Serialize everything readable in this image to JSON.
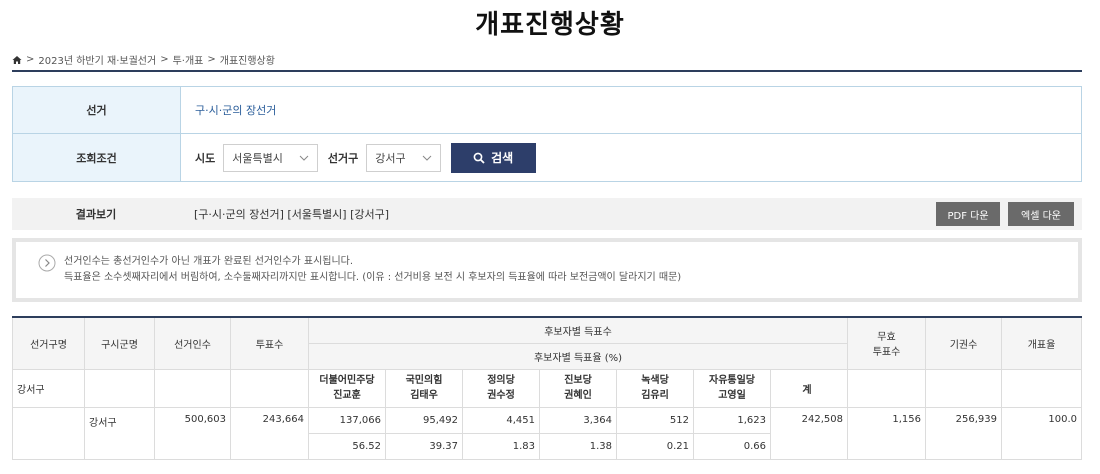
{
  "page_title": "개표진행상황",
  "breadcrumb": {
    "items": [
      "2023년 하반기 재·보궐선거",
      "투·개표",
      "개표진행상황"
    ],
    "separator": ">"
  },
  "search": {
    "election_label": "선거",
    "election_value": "구·시·군의 장선거",
    "condition_label": "조회조건",
    "sido_label": "시도",
    "sido_value": "서울특별시",
    "district_label": "선거구",
    "district_value": "강서구",
    "search_button": "검색"
  },
  "result": {
    "label": "결과보기",
    "value": "[구·시·군의 장선거] [서울특별시] [강서구]",
    "pdf_button": "PDF 다운",
    "excel_button": "엑셀 다운"
  },
  "notice": {
    "line1": "선거인수는 총선거인수가 아닌 개표가 완료된 선거인수가 표시됩니다.",
    "line2": "득표율은 소수셋째자리에서 버림하여, 소수둘째자리까지만 표시합니다. (이유 : 선거비용 보전 시 후보자의 득표율에 따라 보전금액이 달라지기 때문)"
  },
  "table": {
    "headers": {
      "district": "선거구명",
      "sigungu": "구시군명",
      "electors": "선거인수",
      "votes": "투표수",
      "cand_votes": "후보자별 득표수",
      "cand_rate": "후보자별 득표율 (%)",
      "invalid_1": "무효",
      "invalid_2": "투표수",
      "abstain": "기권수",
      "progress": "개표율"
    },
    "district_name": "강서구",
    "candidates": [
      {
        "party": "더불어민주당",
        "name": "진교훈"
      },
      {
        "party": "국민의힘",
        "name": "김태우"
      },
      {
        "party": "정의당",
        "name": "권수정"
      },
      {
        "party": "진보당",
        "name": "권혜인"
      },
      {
        "party": "녹색당",
        "name": "김유리"
      },
      {
        "party": "자유통일당",
        "name": "고영일"
      }
    ],
    "total_label": "계",
    "row": {
      "sigungu": "강서구",
      "electors": "500,603",
      "votes": "243,664",
      "cand_votes": [
        "137,066",
        "95,492",
        "4,451",
        "3,364",
        "512",
        "1,623"
      ],
      "total": "242,508",
      "invalid": "1,156",
      "abstain": "256,939",
      "progress": "100.0",
      "cand_rates": [
        "56.52",
        "39.37",
        "1.83",
        "1.38",
        "0.21",
        "0.66"
      ]
    }
  },
  "colors": {
    "navy": "#2d3e5c",
    "search_button": "#2d3e6a",
    "label_bg": "#eaf4fb",
    "link": "#2a5d9a",
    "download_button": "#6a6a6a"
  }
}
